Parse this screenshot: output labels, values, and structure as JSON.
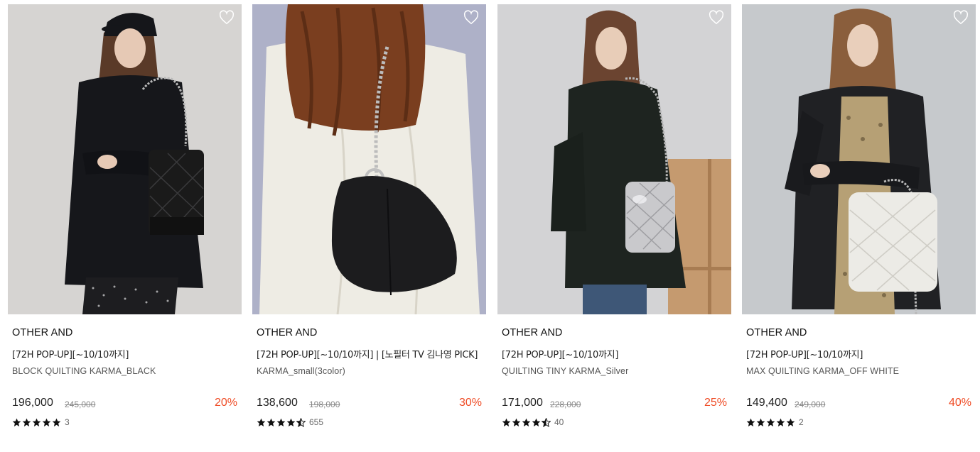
{
  "products": [
    {
      "brand": "OTHER AND",
      "promo": "[72H POP-UP][~10/10까지]",
      "name": "BLOCK QUILTING KARMA_BLACK",
      "price": "196,000",
      "original_price": "245,000",
      "discount": "20%",
      "rating": 5,
      "review_count": "3",
      "bag_color": "#1a1a1a"
    },
    {
      "brand": "OTHER AND",
      "promo": "[72H POP-UP][~10/10까지] | [노필터 TV 김나영 PICK]",
      "name": "KARMA_small(3color)",
      "price": "138,600",
      "original_price": "198,000",
      "discount": "30%",
      "rating": 4.5,
      "review_count": "655",
      "bag_color": "#1c1c1e"
    },
    {
      "brand": "OTHER AND",
      "promo": "[72H POP-UP][~10/10까지]",
      "name": "QUILTING TINY KARMA_Silver",
      "price": "171,000",
      "original_price": "228,000",
      "discount": "25%",
      "rating": 4.5,
      "review_count": "40",
      "bag_color": "#c9c9cc"
    },
    {
      "brand": "OTHER AND",
      "promo": "[72H POP-UP][~10/10까지]",
      "name": "MAX QUILTING KARMA_OFF WHITE",
      "price": "149,400",
      "original_price": "249,000",
      "discount": "40%",
      "rating": 5,
      "review_count": "2",
      "bag_color": "#ecebe6"
    }
  ],
  "icons": {
    "wishlist": "heart-outline-icon",
    "rating": "star-icon"
  },
  "colors": {
    "discount": "#ef4c26",
    "star": "#111111"
  }
}
